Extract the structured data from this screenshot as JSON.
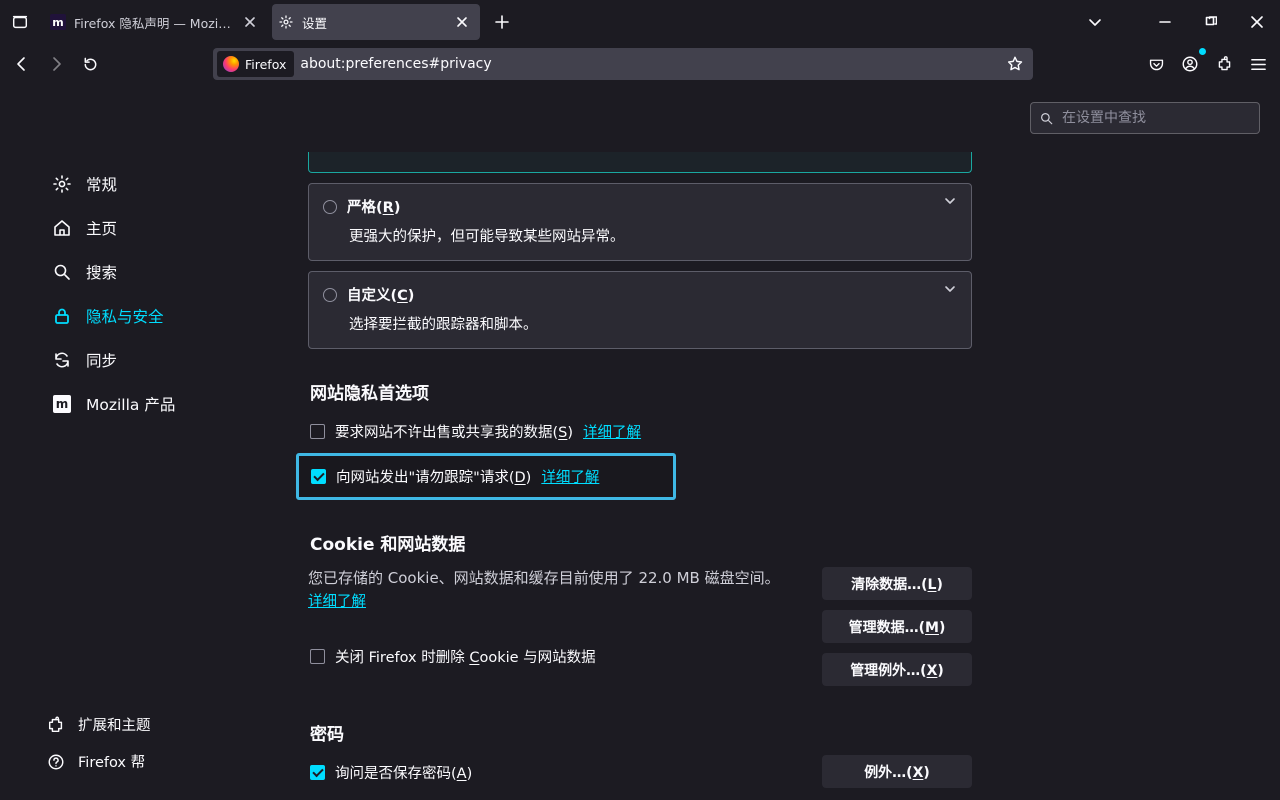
{
  "tabs": {
    "tab1": "Firefox 隐私声明 — Mozilla",
    "tab2": "设置"
  },
  "identity_label": "Firefox",
  "url": "about:preferences#privacy",
  "search_placeholder": "在设置中查找",
  "sidebar": {
    "general": "常规",
    "home": "主页",
    "search": "搜索",
    "privacy": "隐私与安全",
    "sync": "同步",
    "mozilla": "Mozilla 产品",
    "ext": "扩展和主题",
    "help": "Firefox 帮"
  },
  "strict": {
    "title": "严格(R)",
    "desc": "更强大的保护，但可能导致某些网站异常。"
  },
  "custom": {
    "title": "自定义(C)",
    "desc": "选择要拦截的跟踪器和脚本。"
  },
  "privacy_prefs": {
    "heading": "网站隐私首选项",
    "sell": "要求网站不许出售或共享我的数据(S)",
    "dnt": "向网站发出\"请勿跟踪\"请求(D)",
    "learn": "详细了解"
  },
  "cookies": {
    "heading": "Cookie 和网站数据",
    "desc": "您已存储的 Cookie、网站数据和缓存目前使用了 22.0 MB 磁盘空间。",
    "learn": "详细了解",
    "clear": "清除数据…(L)",
    "manage": "管理数据…(M)",
    "exceptions": "管理例外…(X)",
    "delete_on_close": "关闭 Firefox 时删除 Cookie 与网站数据"
  },
  "passwords": {
    "heading": "密码",
    "ask": "询问是否保存密码(A)",
    "exceptions": "例外…(X)"
  }
}
